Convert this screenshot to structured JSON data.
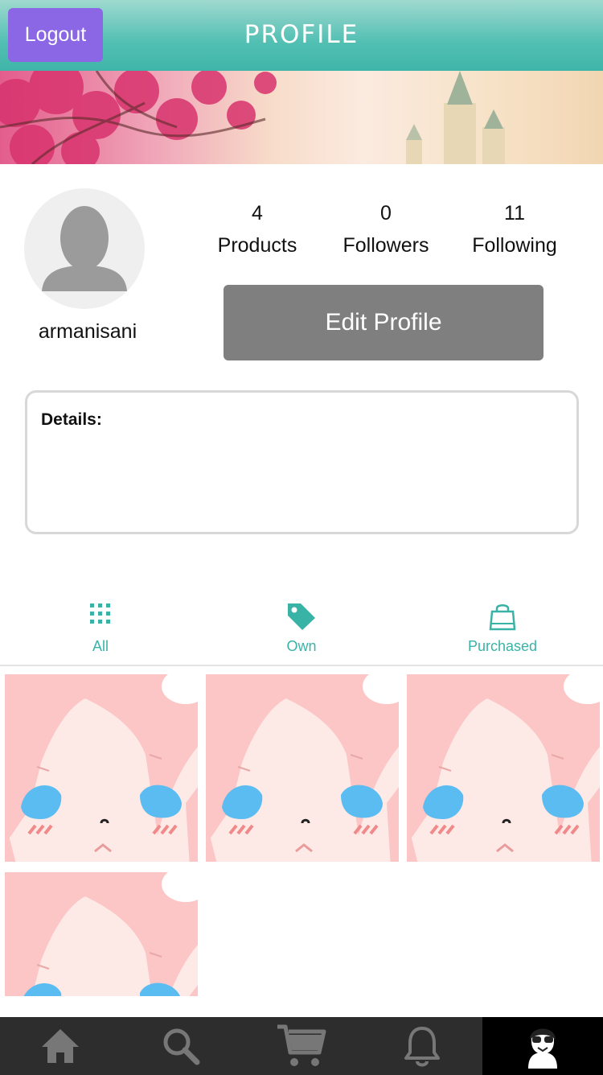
{
  "header": {
    "title": "PROFILE",
    "logout_label": "Logout"
  },
  "profile": {
    "username": "armanisani",
    "stats": [
      {
        "value": "4",
        "label": "Products"
      },
      {
        "value": "0",
        "label": "Followers"
      },
      {
        "value": "11",
        "label": "Following"
      }
    ],
    "edit_label": "Edit Profile",
    "details_label": "Details:"
  },
  "tabs": [
    {
      "label": "All",
      "icon": "grid-icon"
    },
    {
      "label": "Own",
      "icon": "tag-icon"
    },
    {
      "label": "Purchased",
      "icon": "shopping-bag-icon"
    }
  ],
  "products": [
    {
      "image": "anime-girl-thumbnail"
    },
    {
      "image": "anime-girl-thumbnail"
    },
    {
      "image": "anime-girl-thumbnail"
    },
    {
      "image": "anime-girl-thumbnail"
    }
  ],
  "bottom_nav": [
    {
      "icon": "home-icon"
    },
    {
      "icon": "search-icon"
    },
    {
      "icon": "cart-icon"
    },
    {
      "icon": "bell-icon"
    },
    {
      "icon": "profile-icon",
      "active": true
    }
  ],
  "colors": {
    "accent": "#3ab3a7",
    "logout": "#8b67e6",
    "edit_button": "#7f7f7f",
    "nav_bg": "#2d2d2d"
  }
}
